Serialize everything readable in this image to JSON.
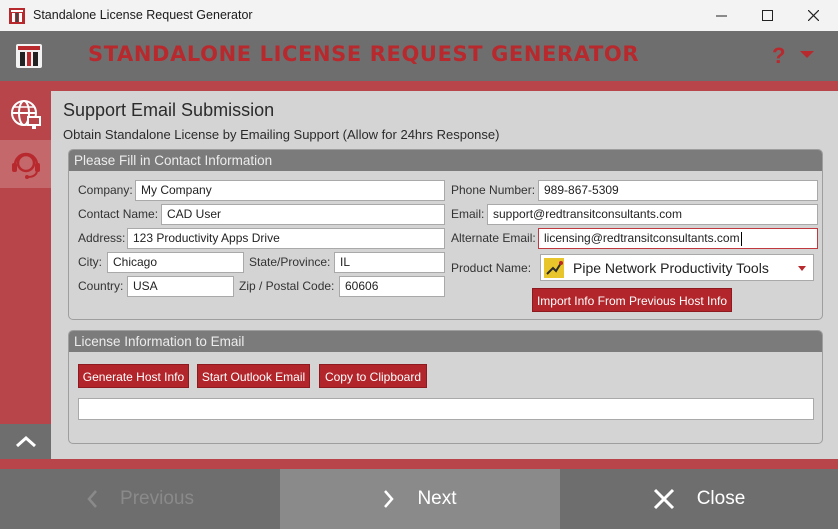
{
  "window": {
    "title": "Standalone License Request Generator"
  },
  "header": {
    "app_title": "STANDALONE LICENSE REQUEST GENERATOR",
    "help_label": "?"
  },
  "page": {
    "title": "Support Email Submission",
    "subtitle": "Obtain Standalone License by Emailing Support (Allow for 24hrs Response)"
  },
  "contact": {
    "heading": "Please Fill in Contact Information",
    "company_label": "Company:",
    "company_value": "My Company",
    "contact_label": "Contact Name:",
    "contact_value": "CAD User",
    "address_label": "Address:",
    "address_value": "123 Productivity Apps Drive",
    "city_label": "City:",
    "city_value": "Chicago",
    "state_label": "State/Province:",
    "state_value": "IL",
    "country_label": "Country:",
    "country_value": "USA",
    "zip_label": "Zip / Postal Code:",
    "zip_value": "60606",
    "phone_label": "Phone Number:",
    "phone_value": "989-867-5309",
    "email_label": "Email:",
    "email_value": "support@redtransitconsultants.com",
    "alt_email_label": "Alternate Email:",
    "alt_email_value": "licensing@redtransitconsultants.com",
    "product_label": "Product Name:",
    "product_value": "Pipe Network Productivity Tools",
    "import_button": "Import Info From Previous Host Info"
  },
  "license": {
    "heading": "License Information to Email",
    "generate_button": "Generate Host Info",
    "outlook_button": "Start Outlook Email",
    "clipboard_button": "Copy to Clipboard",
    "output_value": ""
  },
  "footer": {
    "previous_label": "Previous",
    "next_label": "Next",
    "close_label": "Close"
  },
  "colors": {
    "brand_red": "#b8292e",
    "stripe_red": "#b8454a",
    "header_gray": "#6e6e6e"
  }
}
